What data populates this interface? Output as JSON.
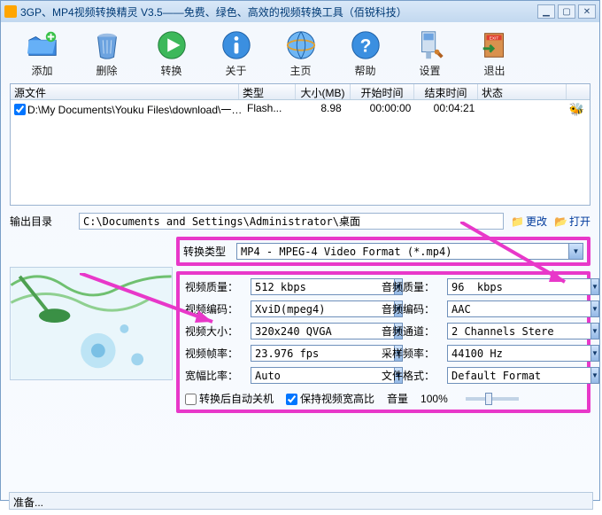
{
  "title": "3GP、MP4视频转换精灵 V3.5——免费、绿色、高效的视频转换工具（佰锐科技）",
  "toolbar": {
    "add": "添加",
    "del": "删除",
    "conv": "转换",
    "about": "关于",
    "home": "主页",
    "help": "帮助",
    "set": "设置",
    "exit": "退出"
  },
  "list": {
    "hdr": {
      "file": "源文件",
      "type": "类型",
      "size": "大小(MB)",
      "start": "开始时间",
      "end": "结束时间",
      "stat": "状态"
    },
    "rows": [
      {
        "file": "D:\\My Documents\\Youku Files\\download\\一…",
        "type": "Flash...",
        "size": "8.98",
        "start": "00:00:00",
        "end": "00:04:21"
      }
    ]
  },
  "out": {
    "lbl": "输出目录",
    "path": "C:\\Documents and Settings\\Administrator\\桌面",
    "change": "更改",
    "open": "打开"
  },
  "type": {
    "lbl": "转换类型",
    "val": "MP4 - MPEG-4 Video Format (*.mp4)"
  },
  "qual": {
    "vq_lbl": "视频质量：",
    "vq": "512 kbps",
    "aq_lbl": "音频质量：",
    "aq": "96  kbps",
    "vc_lbl": "视频编码：",
    "vc": "XviD(mpeg4)",
    "ac_lbl": "音频编码：",
    "ac": "AAC",
    "vs_lbl": "视频大小：",
    "vs": "320x240 QVGA",
    "ach_lbl": "音频通道：",
    "ach": "2 Channels Stere",
    "vfps_lbl": "视频帧率：",
    "vfps": "23.976 fps",
    "sr_lbl": "采样频率：",
    "sr": "44100 Hz",
    "ar_lbl": "宽幅比率：",
    "ar": "Auto",
    "ff_lbl": "文件格式：",
    "ff": "Default Format"
  },
  "opts": {
    "shutdown": "转换后自动关机",
    "keepar": "保持视频宽高比",
    "vol_lbl": "音量",
    "vol": "100%"
  },
  "status": "准备..."
}
